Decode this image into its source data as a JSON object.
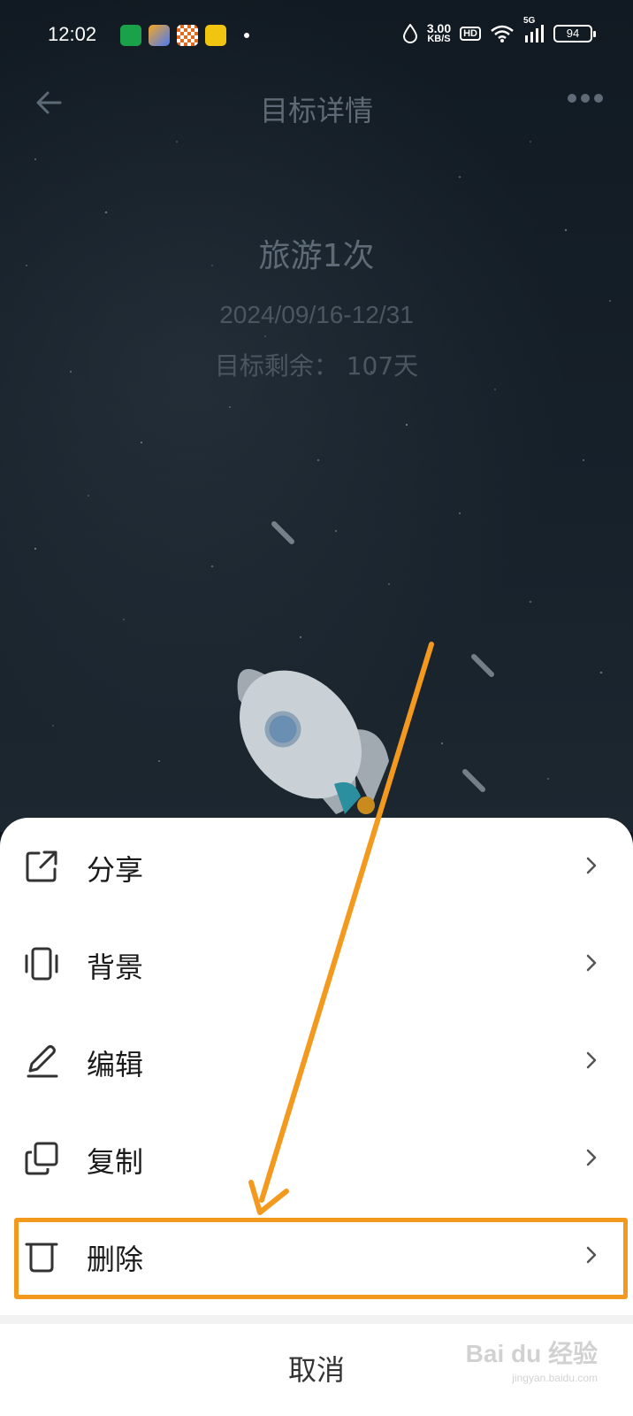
{
  "status_bar": {
    "time": "12:02",
    "net_speed_value": "3.00",
    "net_speed_unit": "KB/S",
    "hd_badge": "HD",
    "signal_label": "5G",
    "battery": "94"
  },
  "header": {
    "title": "目标详情",
    "back_icon": "arrow-left-icon",
    "more_icon": "more-dots-icon"
  },
  "goal": {
    "title": "旅游1次",
    "date_range": "2024/09/16-12/31",
    "remaining": "目标剩余： 107天"
  },
  "action_sheet": {
    "items": [
      {
        "label": "分享",
        "icon": "share-icon"
      },
      {
        "label": "背景",
        "icon": "vibrate-phone-icon"
      },
      {
        "label": "编辑",
        "icon": "pen-icon"
      },
      {
        "label": "复制",
        "icon": "copy-icon"
      },
      {
        "label": "删除",
        "icon": "trash-icon"
      }
    ],
    "cancel_label": "取消"
  },
  "annotation": {
    "highlight_color": "#f39a1e",
    "highlighted_item": "删除"
  },
  "watermark": {
    "text": "Bai du 经验",
    "sub": "jingyan.baidu.com"
  }
}
